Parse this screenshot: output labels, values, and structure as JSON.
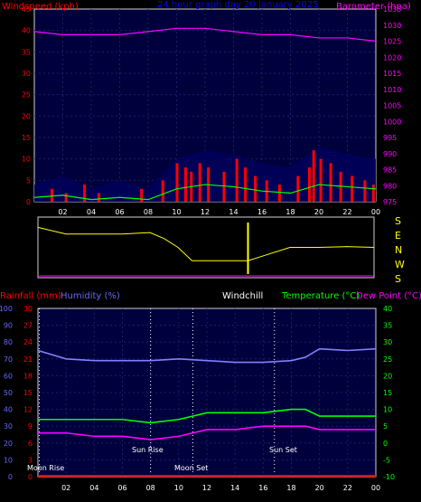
{
  "top_panel": {
    "title": "24 hour graph day  20 January 2025",
    "left_label": "Windspeed (kph)",
    "right_label": "Barometer (hpa)",
    "left_ticks": [
      "0",
      "5",
      "10",
      "15",
      "20",
      "25",
      "30",
      "35",
      "40",
      "45"
    ],
    "right_ticks": [
      "975",
      "980",
      "985",
      "990",
      "995",
      "1000",
      "1005",
      "1010",
      "1015",
      "1020",
      "1025",
      "1030",
      "1035"
    ],
    "x_ticks": [
      "02",
      "04",
      "06",
      "08",
      "10",
      "12",
      "14",
      "16",
      "18",
      "20",
      "22",
      "00"
    ]
  },
  "dir_panel": {
    "labels": [
      "S",
      "E",
      "N",
      "W",
      "S"
    ]
  },
  "bottom_panel": {
    "label_rain": "Rainfall (mm)",
    "label_humidity": "Humidity (%)",
    "label_windchill": "Windchill",
    "label_temp": "Temperature (°C)",
    "label_dew": "Dew Point (°C)",
    "left_humidity_ticks": [
      "0",
      "10",
      "20",
      "30",
      "40",
      "50",
      "60",
      "70",
      "80",
      "90",
      "100"
    ],
    "left_rain_ticks": [
      "0",
      "3",
      "6",
      "9",
      "12",
      "15",
      "18",
      "21",
      "24",
      "27",
      "30"
    ],
    "right_temp_ticks": [
      "-10",
      "-5",
      "0",
      "5",
      "10",
      "15",
      "20",
      "25",
      "30",
      "35",
      "40"
    ],
    "x_ticks": [
      "02",
      "04",
      "06",
      "08",
      "10",
      "12",
      "14",
      "16",
      "18",
      "20",
      "22",
      "00"
    ],
    "annotations": {
      "moon_rise": "Moon Rise",
      "sun_rise": "Sun Rise",
      "moon_set": "Moon Set",
      "sun_set": "Sun Set",
      "x_footer_moon_rise": "Moon Rise 02",
      "x_footer_sun_rise": "Sun Rise",
      "x_footer_sun_set": "16 Sun Set"
    }
  },
  "colors": {
    "bg_plot": "#00003c",
    "wind": "#ff0000",
    "gust_fill": "#00004d",
    "avg_wind": "#00ff00",
    "barometer": "#ff00ff",
    "winddir": "#ffff00",
    "humidity": "#8080ff",
    "temperature": "#00ff00",
    "dewpoint": "#ff00ff",
    "windchill": "#ffffff",
    "rain": "#ff0000",
    "axis_text_left": "#ff0000",
    "axis_text_right": "#ff00ff",
    "axis_text_green": "#00ff00",
    "axis_text_blue": "#6666ff",
    "title": "#0000ff"
  },
  "chart_data": [
    {
      "type": "line",
      "name": "wind-and-barometer",
      "x_hours": [
        0,
        2,
        4,
        6,
        8,
        10,
        12,
        14,
        16,
        18,
        20,
        22,
        24
      ],
      "series": [
        {
          "name": "Barometer",
          "axis": "right",
          "values": [
            1028,
            1027,
            1027,
            1027,
            1028,
            1029,
            1029,
            1028,
            1027,
            1027,
            1026,
            1026,
            1025
          ]
        },
        {
          "name": "Windspeed",
          "axis": "left",
          "values": [
            2,
            3,
            1,
            2,
            1,
            6,
            8,
            7,
            5,
            4,
            8,
            7,
            6
          ]
        },
        {
          "name": "Gust",
          "axis": "left",
          "values": [
            4,
            6,
            3,
            5,
            3,
            10,
            12,
            11,
            9,
            8,
            13,
            11,
            10
          ]
        }
      ],
      "ylim_left": [
        0,
        45
      ],
      "ylim_right": [
        975,
        1035
      ]
    },
    {
      "type": "line",
      "name": "wind-direction",
      "x_hours": [
        0,
        2,
        4,
        6,
        8,
        9,
        10,
        11,
        12,
        14,
        15,
        16,
        18,
        20,
        22,
        24
      ],
      "series": [
        {
          "name": "Direction",
          "values": [
            315,
            270,
            270,
            270,
            280,
            240,
            180,
            90,
            90,
            90,
            90,
            120,
            180,
            180,
            185,
            180
          ]
        }
      ],
      "ylim": [
        0,
        360
      ]
    },
    {
      "type": "line",
      "name": "temp-humidity-rain",
      "x_hours": [
        0,
        2,
        4,
        6,
        8,
        10,
        12,
        14,
        16,
        18,
        19,
        20,
        22,
        24
      ],
      "series": [
        {
          "name": "Humidity",
          "axis": "left",
          "values": [
            75,
            70,
            69,
            69,
            69,
            70,
            69,
            68,
            68,
            69,
            71,
            76,
            75,
            76
          ]
        },
        {
          "name": "Temperature",
          "axis": "right",
          "values": [
            7,
            7,
            7,
            7,
            6,
            7,
            9,
            9,
            9,
            10,
            10,
            8,
            8,
            8
          ]
        },
        {
          "name": "Dew Point",
          "axis": "right",
          "values": [
            3,
            3,
            2,
            2,
            1,
            2,
            4,
            4,
            5,
            5,
            5,
            4,
            4,
            4
          ]
        },
        {
          "name": "Rainfall",
          "axis": "rain",
          "values": [
            0,
            0,
            0,
            0,
            0,
            0,
            0,
            0,
            0,
            0,
            0,
            0,
            0,
            0
          ]
        }
      ],
      "ylim_humidity": [
        0,
        100
      ],
      "ylim_temp": [
        -10,
        40
      ]
    }
  ]
}
